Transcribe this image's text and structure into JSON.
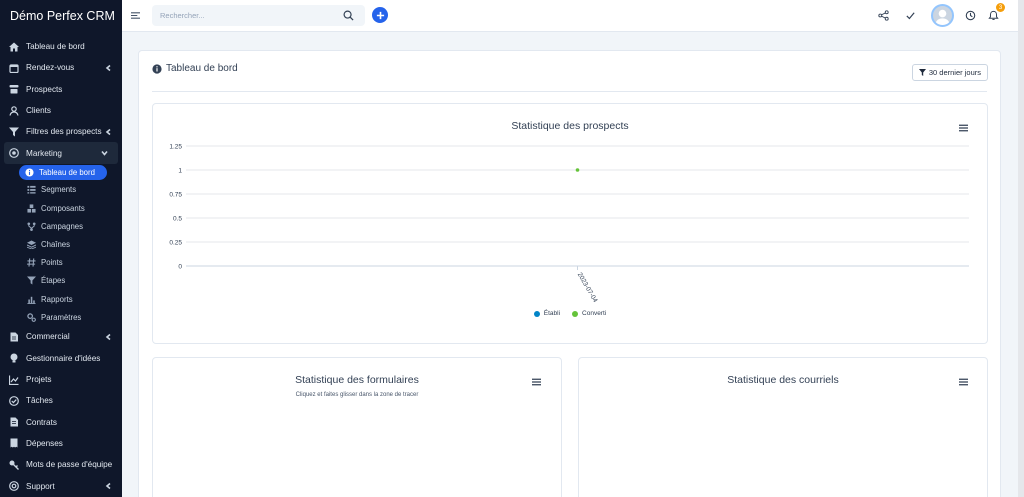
{
  "app": {
    "brand": "Démo Perfex CRM"
  },
  "search": {
    "placeholder": "Rechercher..."
  },
  "notifications": {
    "count": "3"
  },
  "sidebar": {
    "items": [
      {
        "label": "Tableau de bord",
        "icon": "home-icon"
      },
      {
        "label": "Rendez-vous",
        "icon": "calendar-icon",
        "chevron": true
      },
      {
        "label": "Prospects",
        "icon": "tty-icon"
      },
      {
        "label": "Clients",
        "icon": "user-icon"
      },
      {
        "label": "Filtres des prospects",
        "icon": "filter-icon",
        "chevron": true
      },
      {
        "label": "Marketing",
        "icon": "bullseye-icon",
        "chevron": true,
        "expanded": true
      }
    ],
    "submenu": [
      {
        "label": "Tableau de bord",
        "icon": "info-icon",
        "current": true
      },
      {
        "label": "Segments",
        "icon": "segments-icon"
      },
      {
        "label": "Composants",
        "icon": "cubes-icon"
      },
      {
        "label": "Campagnes",
        "icon": "fork-icon"
      },
      {
        "label": "Chaînes",
        "icon": "layers-icon"
      },
      {
        "label": "Points",
        "icon": "hash-icon"
      },
      {
        "label": "Étapes",
        "icon": "funnel-icon"
      },
      {
        "label": "Rapports",
        "icon": "bar-chart-icon"
      },
      {
        "label": "Paramètres",
        "icon": "cogs-icon"
      }
    ],
    "items_after": [
      {
        "label": "Commercial",
        "icon": "file-icon",
        "chevron": true
      },
      {
        "label": "Gestionnaire d'idées",
        "icon": "lightbulb-icon"
      },
      {
        "label": "Projets",
        "icon": "chart-line-icon"
      },
      {
        "label": "Tâches",
        "icon": "check-circle-icon"
      },
      {
        "label": "Contrats",
        "icon": "contract-icon"
      },
      {
        "label": "Dépenses",
        "icon": "receipt-icon"
      },
      {
        "label": "Mots de passe d'équipe",
        "icon": "key-icon"
      },
      {
        "label": "Support",
        "icon": "support-icon",
        "chevron": true
      }
    ]
  },
  "main": {
    "title": "Tableau de bord",
    "filter_label": "30 dernier jours"
  },
  "cards": {
    "prospects": {
      "title": "Statistique des prospects"
    },
    "forms": {
      "title": "Statistique des formulaires",
      "subtitle": "Cliquez et faites glisser dans la zone de tracer"
    },
    "emails": {
      "title": "Statistique des courriels"
    }
  },
  "chart_data": {
    "type": "scatter",
    "title": "Statistique des prospects",
    "x": [
      "2023-07-04"
    ],
    "ylim": [
      0,
      1.25
    ],
    "yticks": [
      0,
      0.25,
      0.5,
      0.75,
      1,
      1.25
    ],
    "grid": true,
    "legend_position": "bottom",
    "series": [
      {
        "name": "Établi",
        "color": "#0284c7",
        "values": [
          0
        ]
      },
      {
        "name": "Converti",
        "color": "#65c33a",
        "values": [
          1
        ]
      }
    ]
  }
}
